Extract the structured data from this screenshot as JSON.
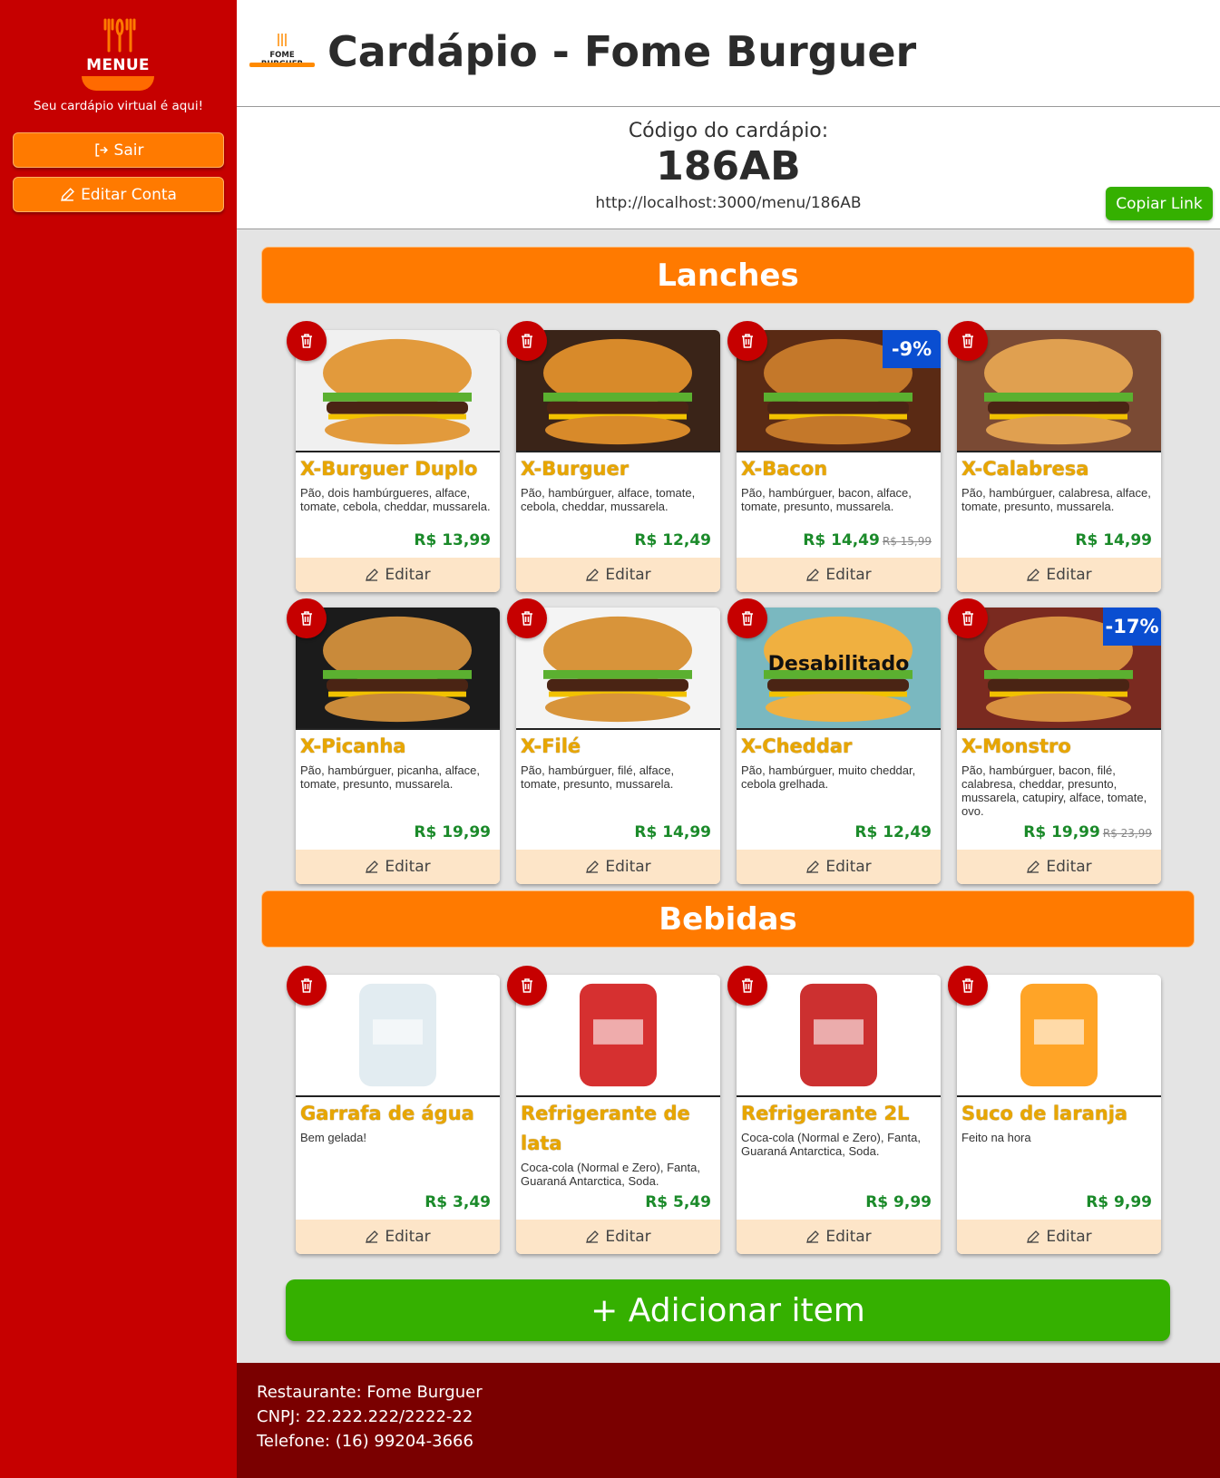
{
  "sidebar": {
    "logo_text": "MENUE",
    "tagline": "Seu cardápio virtual é aqui!",
    "logout_label": "Sair",
    "edit_account_label": "Editar Conta"
  },
  "header": {
    "brand_logo_text": "FOME BURGUER",
    "title": "Cardápio - Fome Burguer"
  },
  "menu_code": {
    "label": "Código do cardápio:",
    "code": "186AB",
    "link": "http://localhost:3000/menu/186AB",
    "copy_label": "Copiar Link"
  },
  "sections": [
    {
      "title": "Lanches",
      "items": [
        {
          "name": "X-Burguer Duplo",
          "desc": "Pão, dois hambúrgueres, alface, tomate, cebola, cheddar, mussarela.",
          "price": "R$ 13,99",
          "old_price": "",
          "discount": "",
          "disabled": "",
          "edit": "Editar"
        },
        {
          "name": "X-Burguer",
          "desc": "Pão, hambúrguer, alface, tomate, cebola, cheddar, mussarela.",
          "price": "R$ 12,49",
          "old_price": "",
          "discount": "",
          "disabled": "",
          "edit": "Editar"
        },
        {
          "name": "X-Bacon",
          "desc": "Pão, hambúrguer, bacon, alface, tomate, presunto, mussarela.",
          "price": "R$ 14,49",
          "old_price": "R$ 15,99",
          "discount": "-9%",
          "disabled": "",
          "edit": "Editar"
        },
        {
          "name": "X-Calabresa",
          "desc": "Pão, hambúrguer, calabresa, alface, tomate, presunto, mussarela.",
          "price": "R$ 14,99",
          "old_price": "",
          "discount": "",
          "disabled": "",
          "edit": "Editar"
        },
        {
          "name": "X-Picanha",
          "desc": "Pão, hambúrguer, picanha, alface, tomate, presunto, mussarela.",
          "price": "R$ 19,99",
          "old_price": "",
          "discount": "",
          "disabled": "",
          "edit": "Editar"
        },
        {
          "name": "X-Filé",
          "desc": "Pão, hambúrguer, filé, alface, tomate, presunto, mussarela.",
          "price": "R$ 14,99",
          "old_price": "",
          "discount": "",
          "disabled": "",
          "edit": "Editar"
        },
        {
          "name": "X-Cheddar",
          "desc": "Pão, hambúrguer, muito cheddar, cebola grelhada.",
          "price": "R$ 12,49",
          "old_price": "",
          "discount": "",
          "disabled": "Desabilitado",
          "edit": "Editar"
        },
        {
          "name": "X-Monstro",
          "desc": "Pão, hambúrguer, bacon, filé, calabresa, cheddar, presunto, mussarela, catupiry, alface, tomate, ovo.",
          "price": "R$ 19,99",
          "old_price": "R$ 23,99",
          "discount": "-17%",
          "disabled": "",
          "edit": "Editar"
        }
      ]
    },
    {
      "title": "Bebidas",
      "items": [
        {
          "name": "Garrafa de água",
          "desc": "Bem gelada!",
          "price": "R$ 3,49",
          "old_price": "",
          "discount": "",
          "disabled": "",
          "edit": "Editar"
        },
        {
          "name": "Refrigerante de lata",
          "desc": "Coca-cola (Normal e Zero), Fanta, Guaraná Antarctica, Soda.",
          "price": "R$ 5,49",
          "old_price": "",
          "discount": "",
          "disabled": "",
          "edit": "Editar"
        },
        {
          "name": "Refrigerante 2L",
          "desc": "Coca-cola (Normal e Zero), Fanta, Guaraná Antarctica, Soda.",
          "price": "R$ 9,99",
          "old_price": "",
          "discount": "",
          "disabled": "",
          "edit": "Editar"
        },
        {
          "name": "Suco de laranja",
          "desc": "Feito na hora",
          "price": "R$ 9,99",
          "old_price": "",
          "discount": "",
          "disabled": "",
          "edit": "Editar"
        }
      ]
    }
  ],
  "add_item_label": "+ Adicionar item",
  "footer": {
    "restaurant": "Restaurante: Fome Burguer",
    "cnpj": "CNPJ: 22.222.222/2222-22",
    "phone": "Telefone: (16) 99204-3666"
  },
  "colors": {
    "sidebar": "#c60000",
    "accent_orange": "#ff7a00",
    "green": "#35b000",
    "discount_blue": "#0a4ed1",
    "footer": "#7a0000",
    "item_name": "#e8a600",
    "price": "#1b8a2a"
  }
}
